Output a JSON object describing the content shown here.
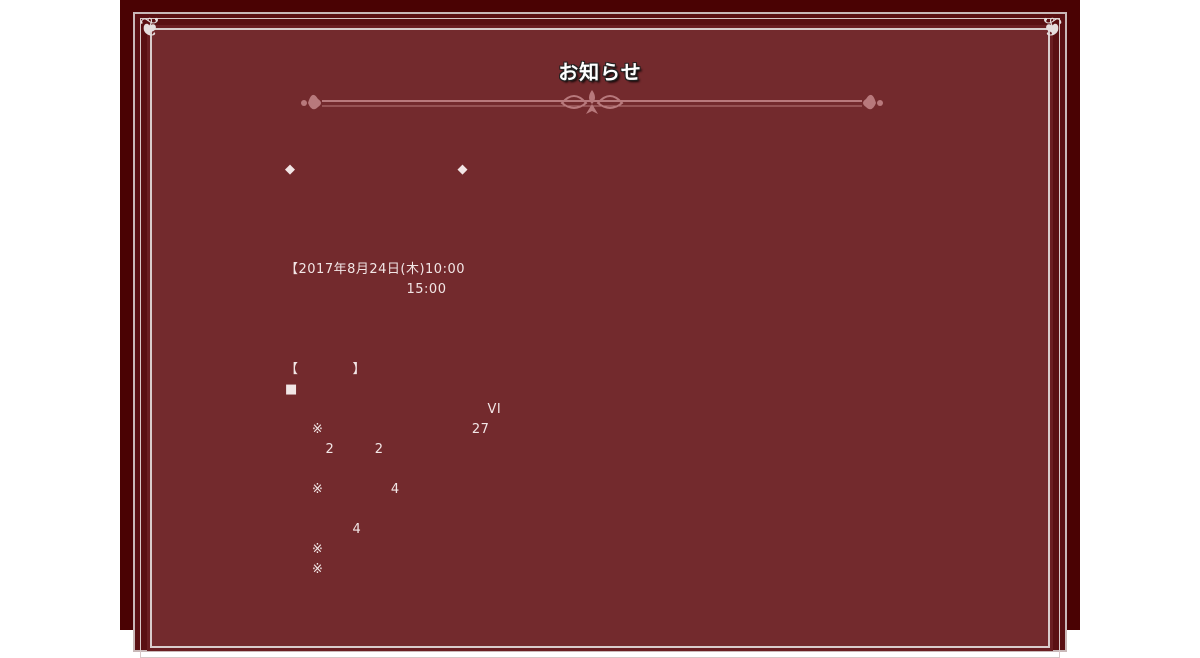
{
  "notice": {
    "title": "お知らせ",
    "lines": [
      "◆　　　　　　　　　　　　◆",
      "",
      "　　　　　　　　　　　　　　　　　　　　　",
      "　　　　　　　　　　　　　　",
      "",
      "【2017年8月24日(木)10:00 　　　　　　　　　　　",
      "　　　　　　　　　15:00 　　　　　　　　　　",
      "",
      "",
      "",
      "【　　　　】",
      "■　　　　　　　",
      "　　　　　　　　　　　　　　　VI　　　　",
      "　　※　　　　　　　　　　　27　　　　　　　　　　　　　",
      "　　　2　　　2　　　　　　　　　　　　　　",
      "　　　　　　　　　　　　　　　　　　　　　　　　　　　　",
      "　　※　　　　　4　　　　　　　　　",
      "　　　　　　　　　　　　　　　　　　　　　　　　　　　　",
      "　　　　　4　　　　　　　　　　　　　",
      "　　※　　　　　　　　　　　　　　　　　　",
      "　　※　　　　　　　　　　　　　　　　　　　　　　　　",
      "　　　　　　　　　　　　　　　　　　　　　　　",
      "　　　　　　　　　　　　　　　　　　　　　",
      "　　　　　　　　　　　　　　　　　　　　　"
    ]
  },
  "colors": {
    "frame": "#4a0203",
    "panel": "#732a2d",
    "ornament": "#b8797c",
    "text": "#f2e6e6"
  },
  "icons": {
    "corner": "ornamental-corner-icon",
    "divider": "fleur-de-lis-divider-icon"
  }
}
